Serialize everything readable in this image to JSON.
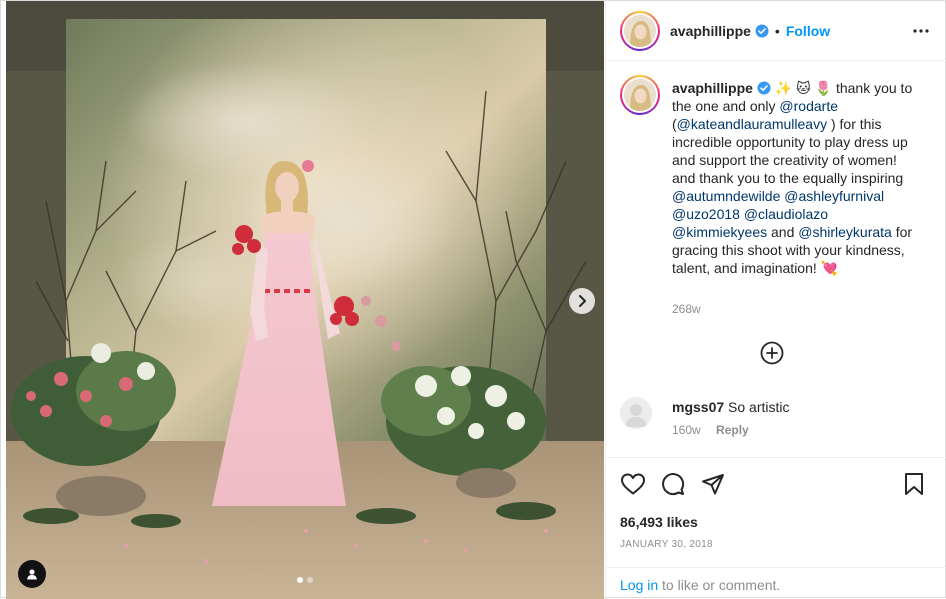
{
  "post": {
    "username": "avaphillippe",
    "follow_label": "Follow",
    "separator": "•"
  },
  "caption": {
    "username": "avaphillippe",
    "emojis": "✨ 🐱 🌷",
    "segments": [
      {
        "type": "text",
        "value": " thank you to the one and only "
      },
      {
        "type": "mention",
        "value": "@rodarte"
      },
      {
        "type": "text",
        "value": " ("
      },
      {
        "type": "mention",
        "value": "@kateandlauramulleavy"
      },
      {
        "type": "text",
        "value": " ) for this incredible opportunity to play dress up and support the creativity of women! and thank you to the equally inspiring "
      },
      {
        "type": "mention",
        "value": "@autumndewilde"
      },
      {
        "type": "text",
        "value": " "
      },
      {
        "type": "mention",
        "value": "@ashleyfurnival"
      },
      {
        "type": "text",
        "value": " "
      },
      {
        "type": "mention",
        "value": "@uzo2018"
      },
      {
        "type": "text",
        "value": " "
      },
      {
        "type": "mention",
        "value": "@claudiolazo"
      },
      {
        "type": "text",
        "value": " "
      },
      {
        "type": "mention",
        "value": "@kimmiekyees"
      },
      {
        "type": "text",
        "value": " and "
      },
      {
        "type": "mention",
        "value": "@shirleykurata"
      },
      {
        "type": "text",
        "value": " for gracing this shoot with your kindness, talent, and imagination! "
      }
    ],
    "end_emoji": "💘",
    "time": "268w"
  },
  "comment": {
    "username": "mgss07",
    "text": "So artistic",
    "time": "160w",
    "reply_label": "Reply"
  },
  "stats": {
    "likes": "86,493 likes",
    "date": "JANUARY 30, 2018"
  },
  "footer": {
    "login_label": "Log in",
    "rest": " to like or comment."
  },
  "carousel": {
    "count": 2,
    "active_index": 0
  },
  "icons": {
    "more": "more-horizontal-icon",
    "add_comment": "plus-circle-icon",
    "like": "heart-icon",
    "comment": "comment-bubble-icon",
    "share": "paper-plane-icon",
    "save": "bookmark-icon",
    "next": "chevron-right-icon",
    "tags": "user-tag-icon",
    "verified": "verified-badge-icon"
  },
  "colors": {
    "accent": "#0095f6",
    "mention": "#00376b",
    "muted": "#8e8e8e",
    "verified": "#3897f0"
  }
}
